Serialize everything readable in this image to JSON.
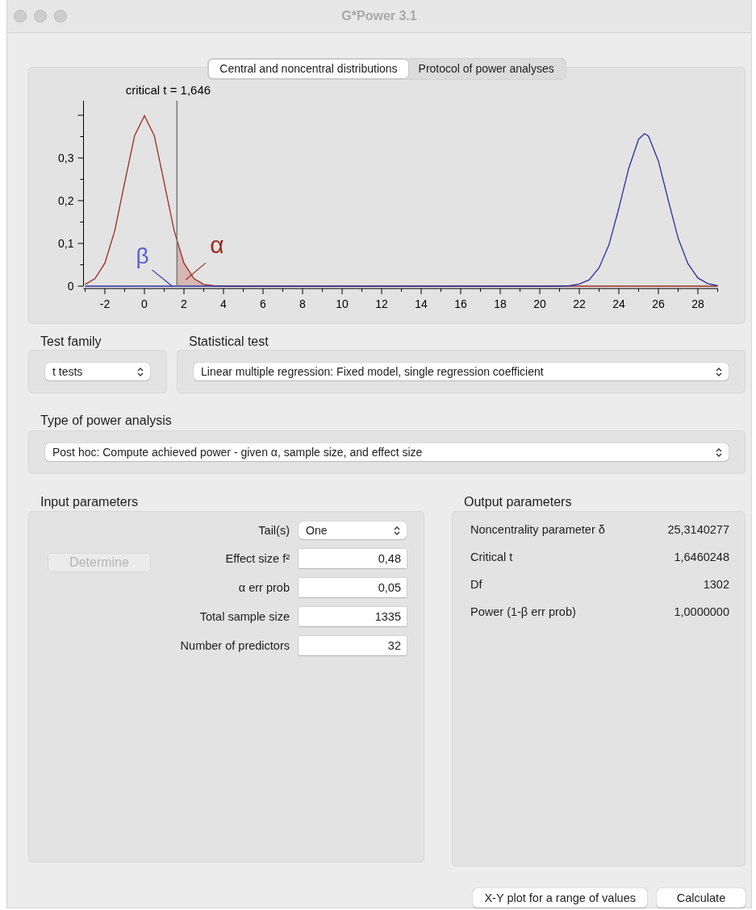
{
  "window": {
    "title": "G*Power 3.1"
  },
  "tabs": [
    {
      "label": "Central and noncentral distributions",
      "selected": true
    },
    {
      "label": "Protocol of power analyses",
      "selected": false
    }
  ],
  "distribution_plot": {
    "chart_data": {
      "type": "line",
      "xlim": [
        -3,
        29
      ],
      "ylim": [
        0,
        0.434
      ],
      "xticks": [
        {
          "value": -2,
          "label": "-2"
        },
        {
          "value": 0,
          "label": "0"
        },
        {
          "value": 2,
          "label": "2"
        },
        {
          "value": 4,
          "label": "4"
        },
        {
          "value": 6,
          "label": "6"
        },
        {
          "value": 8,
          "label": "8"
        },
        {
          "value": 10,
          "label": "10"
        },
        {
          "value": 12,
          "label": "12"
        },
        {
          "value": 14,
          "label": "14"
        },
        {
          "value": 16,
          "label": "16"
        },
        {
          "value": 18,
          "label": "18"
        },
        {
          "value": 20,
          "label": "20"
        },
        {
          "value": 22,
          "label": "22"
        },
        {
          "value": 24,
          "label": "24"
        },
        {
          "value": 26,
          "label": "26"
        },
        {
          "value": 28,
          "label": "28"
        }
      ],
      "yticks": [
        {
          "value": 0,
          "label": "0"
        },
        {
          "value": 0.1,
          "label": "0,1"
        },
        {
          "value": 0.2,
          "label": "0,2"
        },
        {
          "value": 0.3,
          "label": "0,3"
        }
      ],
      "x": [
        -3,
        -2.5,
        -2,
        -1.5,
        -1,
        -0.5,
        0,
        0.5,
        1,
        1.5,
        2,
        2.5,
        3,
        3.5,
        4,
        6,
        8,
        10,
        12,
        14,
        16,
        18,
        20,
        21,
        21.5,
        22,
        22.5,
        23,
        23.5,
        24,
        24.5,
        25,
        25.3,
        25.5,
        26,
        26.5,
        27,
        27.5,
        28,
        28.5,
        29
      ],
      "series": [
        {
          "color": "#9b2c20",
          "values": [
            0.004,
            0.018,
            0.054,
            0.13,
            0.242,
            0.352,
            0.399,
            0.352,
            0.242,
            0.13,
            0.054,
            0.018,
            0.004,
            0.001,
            0,
            0,
            0,
            0,
            0,
            0,
            0,
            0,
            0,
            0,
            0,
            0,
            0,
            0,
            0,
            0,
            0,
            0,
            0,
            0,
            0,
            0,
            0,
            0,
            0,
            0,
            0
          ]
        },
        {
          "color": "#2b2f9e",
          "values": [
            0,
            0,
            0,
            0,
            0,
            0,
            0,
            0,
            0,
            0,
            0,
            0,
            0,
            0,
            0,
            0,
            0,
            0,
            0,
            0,
            0,
            0,
            0,
            0,
            0.001,
            0.005,
            0.015,
            0.043,
            0.097,
            0.182,
            0.276,
            0.344,
            0.357,
            0.351,
            0.293,
            0.201,
            0.112,
            0.052,
            0.019,
            0.006,
            0.001
          ]
        }
      ],
      "ref_lines": [
        {
          "axis": "x",
          "value": 1.646
        }
      ],
      "annotations": [
        "critical t = 1,646",
        "β",
        "α"
      ]
    }
  },
  "test_family": {
    "label": "Test family",
    "value": "t tests"
  },
  "statistical_test": {
    "label": "Statistical test",
    "value": "Linear multiple regression: Fixed model, single regression coefficient"
  },
  "power_analysis_type": {
    "label": "Type of power analysis",
    "value": "Post hoc: Compute achieved power - given α, sample size, and effect size"
  },
  "input_parameters": {
    "title": "Input parameters",
    "determine_button": {
      "label": "Determine",
      "disabled": true
    },
    "fields": [
      {
        "kind": "select",
        "label": "Tail(s)",
        "value": "One"
      },
      {
        "kind": "input",
        "label": "Effect size f²",
        "value": "0,48"
      },
      {
        "kind": "input",
        "label": "α err prob",
        "value": "0,05"
      },
      {
        "kind": "input",
        "label": "Total sample size",
        "value": "1335"
      },
      {
        "kind": "input",
        "label": "Number of predictors",
        "value": "32"
      }
    ]
  },
  "output_parameters": {
    "title": "Output parameters",
    "rows": [
      {
        "label": "Noncentrality parameter δ",
        "value": "25,3140277"
      },
      {
        "label": "Critical t",
        "value": "1,6460248"
      },
      {
        "label": "Df",
        "value": "1302"
      },
      {
        "label": "Power (1-β err prob)",
        "value": "1,0000000"
      }
    ]
  },
  "buttons": [
    "X-Y plot for a range of values",
    "Calculate"
  ]
}
